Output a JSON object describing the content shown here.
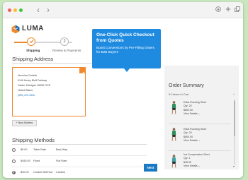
{
  "browser": {
    "back_glyph": "‹",
    "forward_glyph": "›",
    "icons": [
      "download-icon",
      "new-tab-icon",
      "windows-icon"
    ],
    "traffic_lights": [
      "#f25f58",
      "#fbbe2e",
      "#3ac640"
    ]
  },
  "brand": {
    "name": "LUMA",
    "accent": "#f0892e",
    "logo_icon": "luma-logo-icon"
  },
  "progress": {
    "steps": [
      {
        "number": "",
        "label": "Shipping",
        "state": "complete"
      },
      {
        "number": "2",
        "label": "Review & Payments",
        "state": "pending"
      }
    ]
  },
  "shipping_address": {
    "title": "Shipping Address",
    "card": {
      "lines": [
        "Veronica Costello",
        "6146 Honey Bluff Parkway",
        "Calder, Michigan 49628-7978",
        "United States"
      ],
      "phone": "(555) 229-3326"
    },
    "new_address_label": "+ New Address"
  },
  "shipping_methods": {
    "title": "Shipping Methods",
    "rows": [
      {
        "price": "$5.00",
        "method": "Table Rate",
        "carrier": "Best Way",
        "selected": false
      },
      {
        "price": "$455.00",
        "method": "Fixed",
        "carrier": "Flat Rate",
        "selected": false
      },
      {
        "price": "$30.00",
        "method": "Custom Method",
        "carrier": "Custom",
        "selected": true
      }
    ],
    "next_label": "Next"
  },
  "tooltip": {
    "title": "One-Click Quick Checkout from Quotes",
    "body": "Boost Conversions by Pre-Filling Orders for B2B Buyers",
    "color": "#1f8be0"
  },
  "order_summary": {
    "title": "Order Summary",
    "items_label": "91 Items in Cart",
    "items": [
      {
        "name": "Erika Running Short",
        "qty": "Qty: 20",
        "price": "$800.00",
        "link": "View Details ⌄"
      },
      {
        "name": "Erika Running Short",
        "qty": "Qty: 20",
        "price": "$800.00",
        "link": "View Details ⌄"
      },
      {
        "name": "Ina Compression Short",
        "qty": "Qty: 1",
        "price": "$45.00",
        "link": "View Details ⌄"
      }
    ]
  }
}
